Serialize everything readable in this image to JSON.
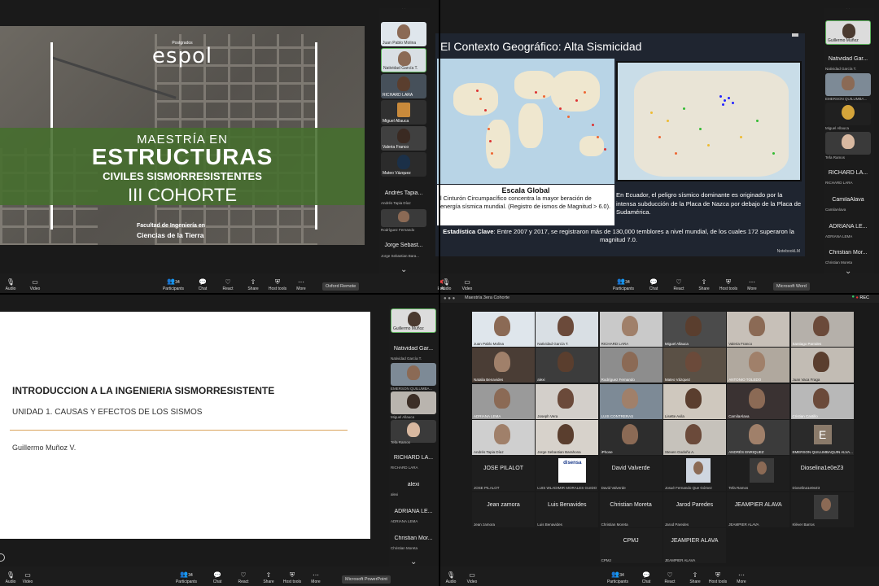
{
  "q1": {
    "slide": {
      "brand_small": "Postgrados",
      "brand": "espol",
      "line1": "MAESTRÍA EN",
      "line2": "ESTRUCTURAS",
      "line3": "CIVILES SISMORRESISTENTES",
      "line4": "III COHORTE",
      "footer1": "Facultad de Ingeniería en",
      "footer2": "Ciencias de la Tierra"
    },
    "strip": {
      "tiles": [
        {
          "name": "Juan Pablo Molina"
        },
        {
          "name": "Natividad García T."
        },
        {
          "name": "RICHARD LARA"
        },
        {
          "name": "Miguel Allauca"
        },
        {
          "name": "Valeria Franco"
        },
        {
          "name": "Mateo Vázquez"
        }
      ],
      "text_items": [
        {
          "big": "Andrés Tapia...",
          "small": "Andrés Tapia Díaz"
        },
        {
          "big": "",
          "small": "Rodríguez Fernando"
        },
        {
          "big": "Jorge Sebast...",
          "small": "Jorge Sebastian Bara..."
        }
      ]
    },
    "toolbar": {
      "audio": "Audio",
      "video": "Video",
      "participants": "Participants",
      "participants_count": "34",
      "chat": "Chat",
      "react": "React",
      "share": "Share",
      "host_tools": "Host tools",
      "more": "More"
    },
    "tooltip": "Oxford Remote"
  },
  "q2": {
    "slide": {
      "title": "El Contexto Geográfico: Alta Sismicidad",
      "global_title": "Escala Global",
      "global_text": "l Cinturón Circumpacífico concentra la mayor beración de energía sísmica mundial. (Registro de ismos de Magnitud > 6.0).",
      "ecuador_text": "En Ecuador, el peligro sísmico dominante es originado por la intensa subducción de la Placa de Nazca por debajo de la Placa de Sudamérica.",
      "key_label": "Estadística Clave",
      "key_text": ": Entre 2007 y 2017, se registraron más de 130,000 temblores a nivel mundial, de los cuales 172 superaron la magnitud 7.0.",
      "footer": "NotebookLM"
    },
    "strip": {
      "top_tile": "Guillermo Muñoz",
      "items": [
        {
          "big": "Natividad Gar...",
          "small": "Natividad García T."
        },
        {
          "big": "",
          "small": "EMERSON QUILUMBA..."
        },
        {
          "big": "",
          "small": "Miguel Allauca"
        },
        {
          "big": "",
          "small": "Tefa Ramos"
        },
        {
          "big": "RICHARD LA...",
          "small": "RICHARD LARA"
        },
        {
          "big": "CamilaAlava",
          "small": "CamilaAlava"
        },
        {
          "big": "ADRIANA LE...",
          "small": "ADRIANA LEMA"
        },
        {
          "big": "Christian Mor...",
          "small": "Christian Moreta"
        }
      ]
    },
    "toolbar": {
      "end": "End",
      "audio": "Audio",
      "video": "Video",
      "participants": "Participants",
      "participants_count": "34",
      "chat": "Chat",
      "react": "React",
      "share": "Share",
      "host_tools": "Host tools",
      "more": "More"
    },
    "tooltip": "Microsoft Word"
  },
  "q3": {
    "slide": {
      "title": "INTRODUCCION A LA INGENIERIA SISMORRESISTENTE",
      "subtitle": "UNIDAD 1. CAUSAS Y EFECTOS DE LOS SISMOS",
      "author": "Guillermo Muñoz V."
    },
    "strip": {
      "top_tile": "Guillermo Muñoz",
      "items": [
        {
          "big": "Natividad Gar...",
          "small": "Natividad García T."
        },
        {
          "big": "",
          "small": "EMERSON QUILUMBA..."
        },
        {
          "big": "",
          "small": "Miguel Allauca"
        },
        {
          "big": "",
          "small": "Tefa Ramos"
        },
        {
          "big": "RICHARD LA...",
          "small": "RICHARD LARA"
        },
        {
          "big": "alexi",
          "small": "alexi"
        },
        {
          "big": "ADRIANA LE...",
          "small": "ADRIANA LEMA"
        },
        {
          "big": "Christian Mor...",
          "small": "Christian Moreta"
        }
      ]
    },
    "toolbar": {
      "audio": "Audio",
      "video": "Video",
      "participants": "Participants",
      "participants_count": "34",
      "chat": "Chat",
      "react": "React",
      "share": "Share",
      "host_tools": "Host tools",
      "more": "More"
    },
    "tooltip": "Microsoft PowerPoint"
  },
  "q4": {
    "window_title": "Maestría 3era Cohorte",
    "rec_label": "REC",
    "video_tiles": [
      {
        "name": "Juan Pablo Molina"
      },
      {
        "name": "Natividad García T."
      },
      {
        "name": "RICHARD LARA"
      },
      {
        "name": "Miguel Allauca"
      },
      {
        "name": "Valeria Franco"
      },
      {
        "name": "Santiago Parrales"
      },
      {
        "name": "Natalia Benavides"
      },
      {
        "name": "alexi"
      },
      {
        "name": "Rodríguez Fernando"
      },
      {
        "name": "Mateo Vázquez"
      },
      {
        "name": "ANTONIO TOLEDO"
      },
      {
        "name": "Juan Vaca Fraga"
      },
      {
        "name": "ADRIANA LEMA"
      },
      {
        "name": "Joseph Vera"
      },
      {
        "name": "LUIS CONTRERAS"
      },
      {
        "name": "Lisette Avila"
      },
      {
        "name": "CamilaAlava"
      },
      {
        "name": "Cristian Castillo"
      },
      {
        "name": "Andrés Tapia Díaz"
      },
      {
        "name": "Jorge Sebastian Barahona"
      },
      {
        "name": "iPhone"
      },
      {
        "name": "Steven Godoño A."
      },
      {
        "name": "ANDRÉS ENRIQUEZ"
      },
      {
        "name": "EMERSON QUILUMBAQUIN ALVA..."
      }
    ],
    "emerson_initial": "E",
    "name_tiles": [
      {
        "big": "JOSE PILALOT",
        "small": "JOSE PILALOT"
      },
      {
        "big": "",
        "small": "LUIS WLADIMIR MORALES GUIDO"
      },
      {
        "big": "David Valverde",
        "small": "David Valverde"
      },
      {
        "big": "",
        "small": "Josué Fernando Que Gómez"
      },
      {
        "big": "",
        "small": "Tefa Ramos"
      },
      {
        "big": "Dioselina1e0eZ3",
        "small": "Dioselina1e0eZ3"
      },
      {
        "big": "Jean zamora",
        "small": "Jean zamora"
      },
      {
        "big": "Luis Benavides",
        "small": "Luis Benavides"
      },
      {
        "big": "Christian Moreta",
        "small": "Christian Moreta"
      },
      {
        "big": "Jarod Paredes",
        "small": "Jarod Paredes"
      },
      {
        "big": "JEAMPIER ALAVA",
        "small": "JEAMPIER ALAVA"
      },
      {
        "big": "",
        "small": "Kléver Barros"
      },
      {
        "big": "CPMJ",
        "small": "CPMJ"
      },
      {
        "big": "JEAMPIER ALAVA",
        "small": "JEAMPIER ALAVA"
      }
    ],
    "logo_text": "disensa",
    "toolbar": {
      "audio": "Audio",
      "video": "Video",
      "participants": "Participants",
      "participants_count": "34",
      "chat": "Chat",
      "react": "React",
      "share": "Share",
      "host_tools": "Host tools",
      "more": "More"
    }
  }
}
